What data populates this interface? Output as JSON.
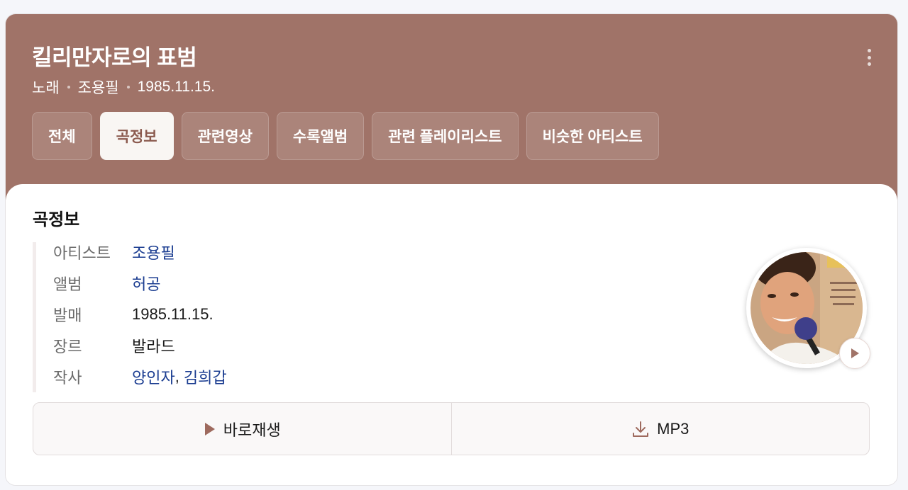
{
  "song": {
    "title": "킬리만자로의 표범",
    "type": "노래",
    "artist": "조용필",
    "date": "1985.11.15."
  },
  "tabs": [
    {
      "label": "전체",
      "active": false
    },
    {
      "label": "곡정보",
      "active": true
    },
    {
      "label": "관련영상",
      "active": false
    },
    {
      "label": "수록앨범",
      "active": false
    },
    {
      "label": "관련 플레이리스트",
      "active": false
    },
    {
      "label": "비슷한 아티스트",
      "active": false
    }
  ],
  "section": {
    "title": "곡정보"
  },
  "info": {
    "artist_label": "아티스트",
    "artist_value": "조용필",
    "album_label": "앨범",
    "album_value": "허공",
    "release_label": "발매",
    "release_value": "1985.11.15.",
    "genre_label": "장르",
    "genre_value": "발라드",
    "lyricist_label": "작사",
    "lyricist_1": "양인자",
    "lyricist_sep": ",",
    "lyricist_2": "김희갑"
  },
  "actions": {
    "play_label": "바로재생",
    "mp3_label": "MP3"
  },
  "colors": {
    "hero_bg": "#a07368",
    "link": "#1b3d91",
    "accent": "#8b5a4e"
  },
  "icons": {
    "more": "more-vertical-icon",
    "play": "play-icon",
    "download": "download-icon"
  }
}
